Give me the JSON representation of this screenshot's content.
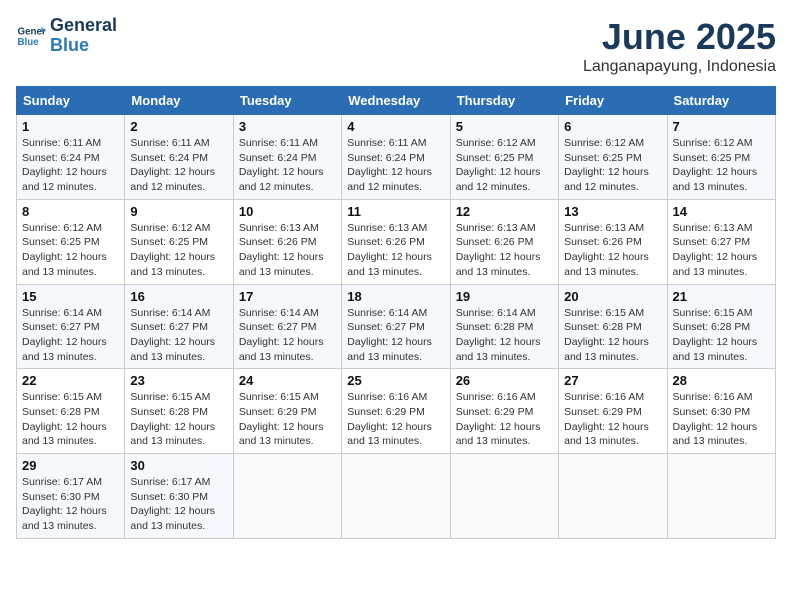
{
  "header": {
    "logo_line1": "General",
    "logo_line2": "Blue",
    "title": "June 2025",
    "subtitle": "Langanapayung, Indonesia"
  },
  "weekdays": [
    "Sunday",
    "Monday",
    "Tuesday",
    "Wednesday",
    "Thursday",
    "Friday",
    "Saturday"
  ],
  "rows": [
    [
      {
        "day": "1",
        "lines": [
          "Sunrise: 6:11 AM",
          "Sunset: 6:24 PM",
          "Daylight: 12 hours",
          "and 12 minutes."
        ]
      },
      {
        "day": "2",
        "lines": [
          "Sunrise: 6:11 AM",
          "Sunset: 6:24 PM",
          "Daylight: 12 hours",
          "and 12 minutes."
        ]
      },
      {
        "day": "3",
        "lines": [
          "Sunrise: 6:11 AM",
          "Sunset: 6:24 PM",
          "Daylight: 12 hours",
          "and 12 minutes."
        ]
      },
      {
        "day": "4",
        "lines": [
          "Sunrise: 6:11 AM",
          "Sunset: 6:24 PM",
          "Daylight: 12 hours",
          "and 12 minutes."
        ]
      },
      {
        "day": "5",
        "lines": [
          "Sunrise: 6:12 AM",
          "Sunset: 6:25 PM",
          "Daylight: 12 hours",
          "and 12 minutes."
        ]
      },
      {
        "day": "6",
        "lines": [
          "Sunrise: 6:12 AM",
          "Sunset: 6:25 PM",
          "Daylight: 12 hours",
          "and 12 minutes."
        ]
      },
      {
        "day": "7",
        "lines": [
          "Sunrise: 6:12 AM",
          "Sunset: 6:25 PM",
          "Daylight: 12 hours",
          "and 13 minutes."
        ]
      }
    ],
    [
      {
        "day": "8",
        "lines": [
          "Sunrise: 6:12 AM",
          "Sunset: 6:25 PM",
          "Daylight: 12 hours",
          "and 13 minutes."
        ]
      },
      {
        "day": "9",
        "lines": [
          "Sunrise: 6:12 AM",
          "Sunset: 6:25 PM",
          "Daylight: 12 hours",
          "and 13 minutes."
        ]
      },
      {
        "day": "10",
        "lines": [
          "Sunrise: 6:13 AM",
          "Sunset: 6:26 PM",
          "Daylight: 12 hours",
          "and 13 minutes."
        ]
      },
      {
        "day": "11",
        "lines": [
          "Sunrise: 6:13 AM",
          "Sunset: 6:26 PM",
          "Daylight: 12 hours",
          "and 13 minutes."
        ]
      },
      {
        "day": "12",
        "lines": [
          "Sunrise: 6:13 AM",
          "Sunset: 6:26 PM",
          "Daylight: 12 hours",
          "and 13 minutes."
        ]
      },
      {
        "day": "13",
        "lines": [
          "Sunrise: 6:13 AM",
          "Sunset: 6:26 PM",
          "Daylight: 12 hours",
          "and 13 minutes."
        ]
      },
      {
        "day": "14",
        "lines": [
          "Sunrise: 6:13 AM",
          "Sunset: 6:27 PM",
          "Daylight: 12 hours",
          "and 13 minutes."
        ]
      }
    ],
    [
      {
        "day": "15",
        "lines": [
          "Sunrise: 6:14 AM",
          "Sunset: 6:27 PM",
          "Daylight: 12 hours",
          "and 13 minutes."
        ]
      },
      {
        "day": "16",
        "lines": [
          "Sunrise: 6:14 AM",
          "Sunset: 6:27 PM",
          "Daylight: 12 hours",
          "and 13 minutes."
        ]
      },
      {
        "day": "17",
        "lines": [
          "Sunrise: 6:14 AM",
          "Sunset: 6:27 PM",
          "Daylight: 12 hours",
          "and 13 minutes."
        ]
      },
      {
        "day": "18",
        "lines": [
          "Sunrise: 6:14 AM",
          "Sunset: 6:27 PM",
          "Daylight: 12 hours",
          "and 13 minutes."
        ]
      },
      {
        "day": "19",
        "lines": [
          "Sunrise: 6:14 AM",
          "Sunset: 6:28 PM",
          "Daylight: 12 hours",
          "and 13 minutes."
        ]
      },
      {
        "day": "20",
        "lines": [
          "Sunrise: 6:15 AM",
          "Sunset: 6:28 PM",
          "Daylight: 12 hours",
          "and 13 minutes."
        ]
      },
      {
        "day": "21",
        "lines": [
          "Sunrise: 6:15 AM",
          "Sunset: 6:28 PM",
          "Daylight: 12 hours",
          "and 13 minutes."
        ]
      }
    ],
    [
      {
        "day": "22",
        "lines": [
          "Sunrise: 6:15 AM",
          "Sunset: 6:28 PM",
          "Daylight: 12 hours",
          "and 13 minutes."
        ]
      },
      {
        "day": "23",
        "lines": [
          "Sunrise: 6:15 AM",
          "Sunset: 6:28 PM",
          "Daylight: 12 hours",
          "and 13 minutes."
        ]
      },
      {
        "day": "24",
        "lines": [
          "Sunrise: 6:15 AM",
          "Sunset: 6:29 PM",
          "Daylight: 12 hours",
          "and 13 minutes."
        ]
      },
      {
        "day": "25",
        "lines": [
          "Sunrise: 6:16 AM",
          "Sunset: 6:29 PM",
          "Daylight: 12 hours",
          "and 13 minutes."
        ]
      },
      {
        "day": "26",
        "lines": [
          "Sunrise: 6:16 AM",
          "Sunset: 6:29 PM",
          "Daylight: 12 hours",
          "and 13 minutes."
        ]
      },
      {
        "day": "27",
        "lines": [
          "Sunrise: 6:16 AM",
          "Sunset: 6:29 PM",
          "Daylight: 12 hours",
          "and 13 minutes."
        ]
      },
      {
        "day": "28",
        "lines": [
          "Sunrise: 6:16 AM",
          "Sunset: 6:30 PM",
          "Daylight: 12 hours",
          "and 13 minutes."
        ]
      }
    ],
    [
      {
        "day": "29",
        "lines": [
          "Sunrise: 6:17 AM",
          "Sunset: 6:30 PM",
          "Daylight: 12 hours",
          "and 13 minutes."
        ]
      },
      {
        "day": "30",
        "lines": [
          "Sunrise: 6:17 AM",
          "Sunset: 6:30 PM",
          "Daylight: 12 hours",
          "and 13 minutes."
        ]
      },
      {
        "day": "",
        "lines": []
      },
      {
        "day": "",
        "lines": []
      },
      {
        "day": "",
        "lines": []
      },
      {
        "day": "",
        "lines": []
      },
      {
        "day": "",
        "lines": []
      }
    ]
  ]
}
